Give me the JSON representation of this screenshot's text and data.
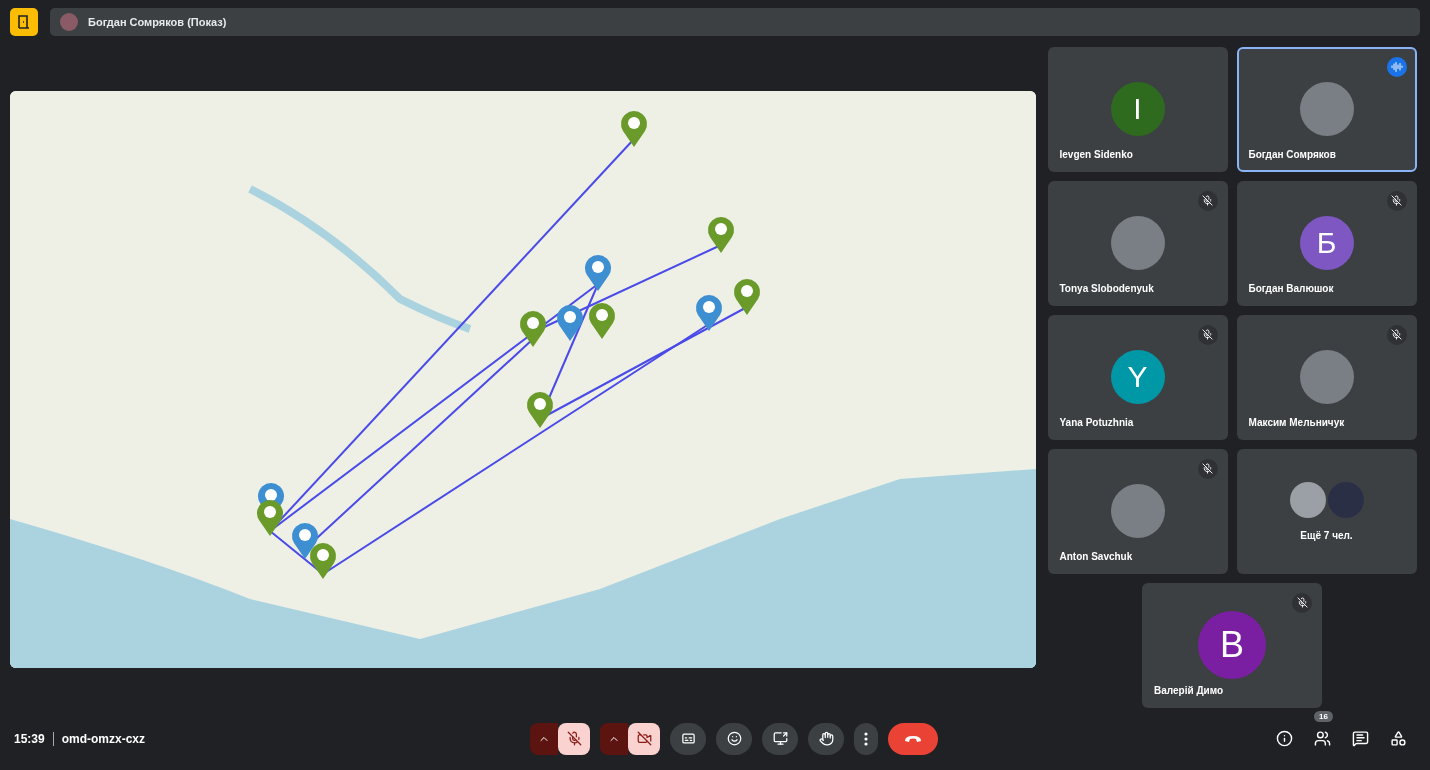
{
  "presenter": {
    "name": "Богдан Сомряков (Показ)"
  },
  "participants": [
    {
      "kind": "initial",
      "name": "Ievgen Sidenko",
      "initial": "I",
      "color": "#2e6b1f",
      "muted": false,
      "speaking": false
    },
    {
      "kind": "photo",
      "name": "Богдан Сомряков",
      "muted": false,
      "speaking": true
    },
    {
      "kind": "photo",
      "name": "Tonya Slobodenyuk",
      "muted": true,
      "speaking": false
    },
    {
      "kind": "initial",
      "name": "Богдан Валюшок",
      "initial": "Б",
      "color": "#7e57c2",
      "muted": true,
      "speaking": false
    },
    {
      "kind": "initial",
      "name": "Yana Potuzhnia",
      "initial": "Y",
      "color": "#0097a7",
      "muted": true,
      "speaking": false
    },
    {
      "kind": "photo",
      "name": "Максим Мельничук",
      "muted": true,
      "speaking": false
    },
    {
      "kind": "photo",
      "name": "Anton Savchuk",
      "muted": true,
      "speaking": false
    },
    {
      "kind": "overflow",
      "name": "Ещё 7 чел.",
      "muted": false,
      "speaking": false
    },
    {
      "kind": "initial",
      "name": "Валерій Димо",
      "initial": "В",
      "color": "#7b1fa2",
      "muted": true,
      "speaking": false
    }
  ],
  "footer": {
    "time": "15:39",
    "meeting_code": "omd-omzx-cxz",
    "people_count": "16"
  },
  "controls": {
    "mic_on": false,
    "camera_on": false
  }
}
